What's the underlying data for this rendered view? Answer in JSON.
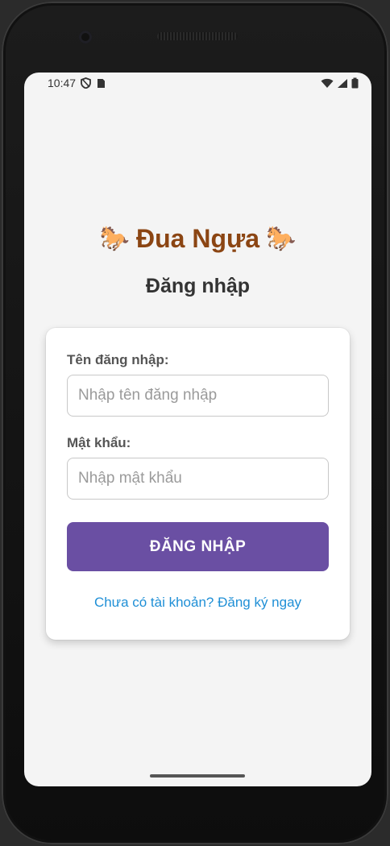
{
  "status_bar": {
    "time": "10:47",
    "left_icons": [
      "shield-icon",
      "sim-card-icon"
    ],
    "right_icons": [
      "wifi-icon",
      "signal-icon",
      "battery-icon"
    ]
  },
  "app": {
    "title": "Đua Ngựa",
    "horse_emoji": "🐎",
    "subtitle": "Đăng nhập"
  },
  "form": {
    "username_label": "Tên đăng nhập:",
    "username_placeholder": "Nhập tên đăng nhập",
    "username_value": "",
    "password_label": "Mật khẩu:",
    "password_placeholder": "Nhập mật khẩu",
    "password_value": "",
    "login_button_label": "ĐĂNG NHẬP",
    "register_link": "Chưa có tài khoản? Đăng ký ngay"
  },
  "colors": {
    "title": "#8b4513",
    "button": "#6a4fa3",
    "link": "#1f8fd6",
    "background": "#f4f4f4"
  }
}
